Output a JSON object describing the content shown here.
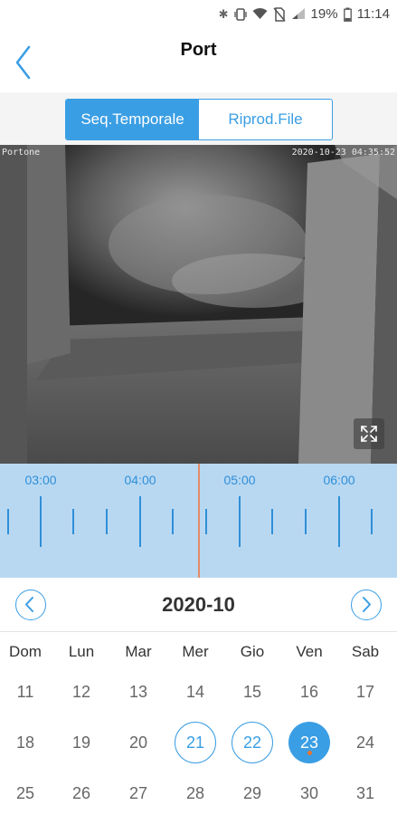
{
  "status_bar": {
    "battery": "19%",
    "time": "11:14"
  },
  "header": {
    "title": "Port"
  },
  "mode_tabs": [
    {
      "label": "Seq.Temporale",
      "active": true
    },
    {
      "label": "Riprod.File",
      "active": false
    }
  ],
  "video": {
    "camera_name": "Portone",
    "timestamp": "2020-10-23 04:35:52"
  },
  "timeline": {
    "labels": [
      "03:00",
      "04:00",
      "05:00",
      "06:00"
    ]
  },
  "calendar": {
    "month": "2020-10",
    "weekdays": [
      "Dom",
      "Lun",
      "Mar",
      "Mer",
      "Gio",
      "Ven",
      "Sab"
    ],
    "rows": [
      [
        "11",
        "12",
        "13",
        "14",
        "15",
        "16",
        "17"
      ],
      [
        "18",
        "19",
        "20",
        "21",
        "22",
        "23",
        "24"
      ],
      [
        "25",
        "26",
        "27",
        "28",
        "29",
        "30",
        "31"
      ]
    ],
    "recorded_days": [
      "21",
      "22"
    ],
    "selected_day": "23"
  },
  "colors": {
    "accent": "#3a9ee4",
    "timeline_bg": "#b8d8f2",
    "cursor": "#e48b6a",
    "event_dot": "#e87530"
  }
}
